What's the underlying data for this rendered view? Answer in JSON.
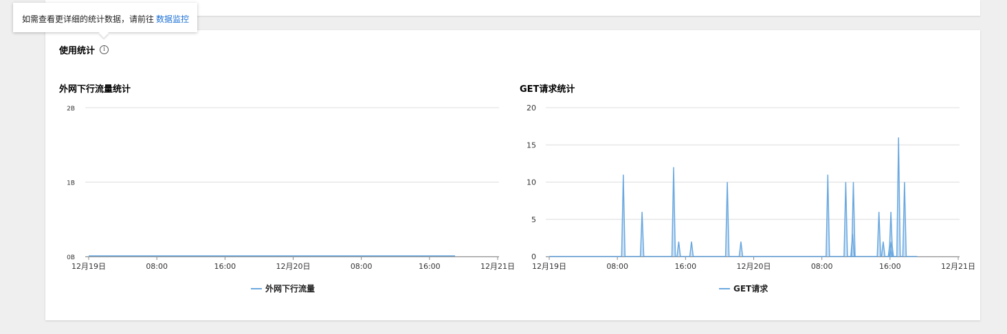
{
  "tooltip": {
    "text": "如需查看更详细的统计数据，请前往",
    "link": "数据监控"
  },
  "section": {
    "title": "使用统计",
    "info_icon": "info-circle-icon"
  },
  "colors": {
    "series": "#6aa8e0",
    "link": "#1a6fd4",
    "grid": "#dcdcdc"
  },
  "chart_data": [
    {
      "type": "line",
      "title": "外网下行流量统计",
      "y_ticks": [
        "0B",
        "1B",
        "2B"
      ],
      "ylim": [
        0,
        2
      ],
      "x_ticks": [
        "12月19日",
        "08:00",
        "16:00",
        "12月20日",
        "08:00",
        "16:00",
        "12月21日"
      ],
      "xlim_hours": [
        0,
        48
      ],
      "legend": "外网下行流量",
      "series": [
        {
          "name": "外网下行流量",
          "x": [
            0,
            43
          ],
          "values": [
            0,
            0
          ]
        }
      ]
    },
    {
      "type": "line",
      "title": "GET请求统计",
      "y_ticks": [
        "0",
        "5",
        "10",
        "15",
        "20"
      ],
      "ylim": [
        0,
        20
      ],
      "x_ticks": [
        "12月19日",
        "08:00",
        "16:00",
        "12月20日",
        "08:00",
        "16:00",
        "12月21日"
      ],
      "xlim_hours": [
        0,
        48
      ],
      "legend": "GET请求",
      "series": [
        {
          "name": "GET请求",
          "spikes": [
            [
              8.7,
              11
            ],
            [
              10.9,
              6
            ],
            [
              14.6,
              12
            ],
            [
              15.2,
              2
            ],
            [
              16.7,
              2
            ],
            [
              20.9,
              10
            ],
            [
              22.5,
              2
            ],
            [
              32.7,
              11
            ],
            [
              34.8,
              10
            ],
            [
              35.6,
              3
            ],
            [
              35.7,
              10
            ],
            [
              38.7,
              6
            ],
            [
              39.2,
              2
            ],
            [
              40.0,
              2
            ],
            [
              40.1,
              6
            ],
            [
              40.2,
              2
            ],
            [
              41.0,
              16
            ],
            [
              41.7,
              10
            ]
          ],
          "x_end": 43.2
        }
      ]
    }
  ]
}
